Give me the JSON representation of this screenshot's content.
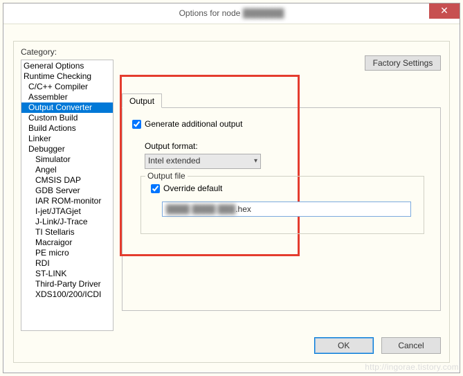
{
  "title": "Options for node",
  "title_redacted": "███████",
  "close": "✕",
  "category_label": "Category:",
  "categories": [
    {
      "label": "General Options",
      "indent": 0
    },
    {
      "label": "Runtime Checking",
      "indent": 0
    },
    {
      "label": "C/C++ Compiler",
      "indent": 1
    },
    {
      "label": "Assembler",
      "indent": 1
    },
    {
      "label": "Output Converter",
      "indent": 1,
      "selected": true
    },
    {
      "label": "Custom Build",
      "indent": 1
    },
    {
      "label": "Build Actions",
      "indent": 1
    },
    {
      "label": "Linker",
      "indent": 1
    },
    {
      "label": "Debugger",
      "indent": 1
    },
    {
      "label": "Simulator",
      "indent": 2
    },
    {
      "label": "Angel",
      "indent": 2
    },
    {
      "label": "CMSIS DAP",
      "indent": 2
    },
    {
      "label": "GDB Server",
      "indent": 2
    },
    {
      "label": "IAR ROM-monitor",
      "indent": 2
    },
    {
      "label": "I-jet/JTAGjet",
      "indent": 2
    },
    {
      "label": "J-Link/J-Trace",
      "indent": 2
    },
    {
      "label": "TI Stellaris",
      "indent": 2
    },
    {
      "label": "Macraigor",
      "indent": 2
    },
    {
      "label": "PE micro",
      "indent": 2
    },
    {
      "label": "RDI",
      "indent": 2
    },
    {
      "label": "ST-LINK",
      "indent": 2
    },
    {
      "label": "Third-Party Driver",
      "indent": 2
    },
    {
      "label": "XDS100/200/ICDI",
      "indent": 2
    }
  ],
  "factory_btn": "Factory Settings",
  "tab_label": "Output",
  "generate_label": "Generate additional output",
  "format_label": "Output format:",
  "format_value": "Intel extended",
  "fieldset_label": "Output file",
  "override_label": "Override default",
  "file_redacted": "████ ████ ███",
  "file_ext": ".hex",
  "ok_btn": "OK",
  "cancel_btn": "Cancel",
  "watermark": "http://ingorae.tistory.com"
}
